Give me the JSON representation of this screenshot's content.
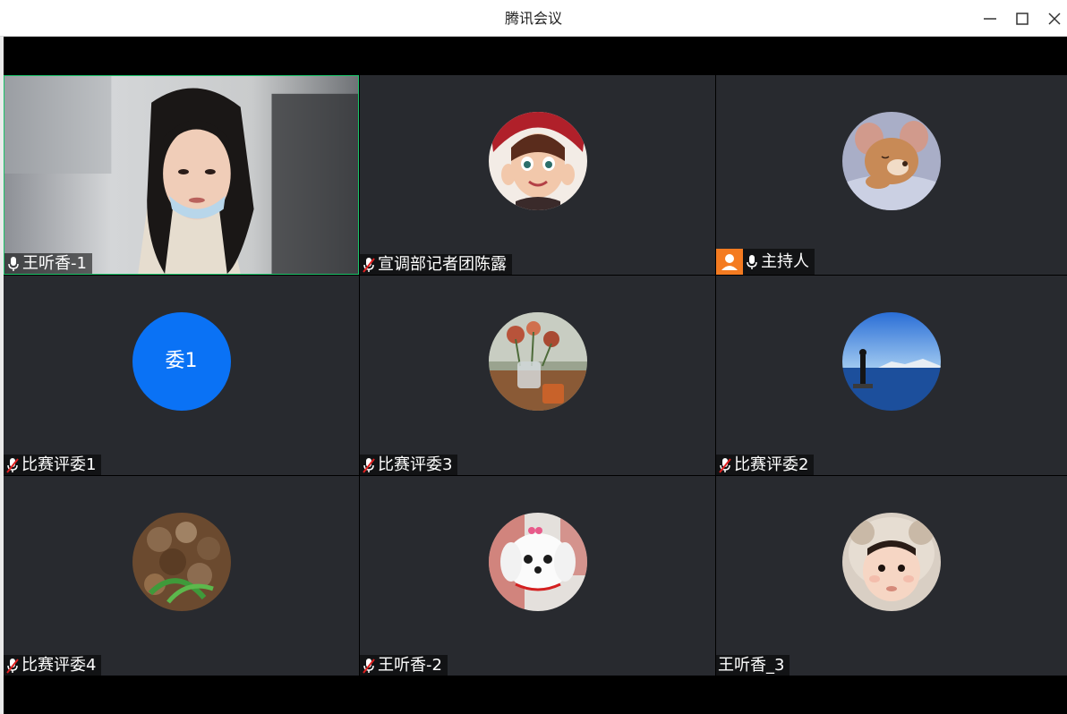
{
  "window": {
    "title": "腾讯会议"
  },
  "colors": {
    "active_border": "#1bc46a",
    "tile_bg": "#282a2f",
    "host_badge": "#f47b21",
    "text_avatar": "#0a72f5",
    "muted_mic": "#e02020"
  },
  "participants": [
    {
      "name": "王听香-1",
      "mic": "on",
      "avatar": "live-video",
      "active": true
    },
    {
      "name": "宣调部记者团陈露",
      "mic": "muted",
      "avatar": "cartoon-girl-avatar"
    },
    {
      "name": "主持人",
      "mic": "on",
      "host": true,
      "avatar": "sleeping-mouse-avatar"
    },
    {
      "name": "比赛评委1",
      "mic": "muted",
      "avatar_text": "委1"
    },
    {
      "name": "比赛评委3",
      "mic": "muted",
      "avatar": "flowers-tea-avatar"
    },
    {
      "name": "比赛评委2",
      "mic": "muted",
      "avatar": "lake-person-avatar"
    },
    {
      "name": "比赛评委4",
      "mic": "muted",
      "avatar": "mushroom-food-avatar"
    },
    {
      "name": "王听香-2",
      "mic": "muted",
      "avatar": "white-puppy-avatar"
    },
    {
      "name": "王听香_3",
      "mic": "none",
      "avatar": "baby-avatar"
    }
  ]
}
